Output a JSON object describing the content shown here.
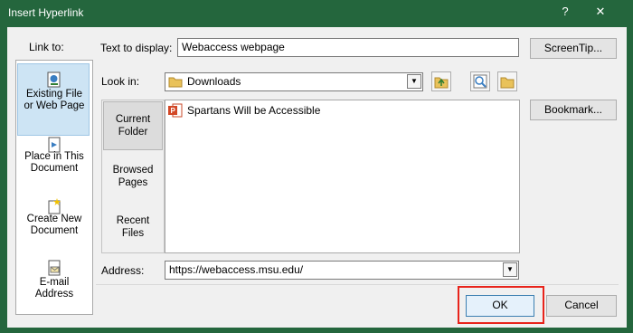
{
  "window": {
    "title": "Insert Hyperlink",
    "help_label": "?",
    "close_label": "✕"
  },
  "link_to": {
    "label": "Link to:",
    "items": [
      {
        "line1": "Existing File",
        "line2": "or Web Page",
        "icon": "existing-file-icon",
        "selected": true
      },
      {
        "line1": "Place in This",
        "line2": "Document",
        "icon": "place-in-document-icon",
        "selected": false
      },
      {
        "line1": "Create New",
        "line2": "Document",
        "icon": "new-document-icon",
        "selected": false
      },
      {
        "line1": "E-mail",
        "line2": "Address",
        "icon": "email-address-icon",
        "selected": false
      }
    ]
  },
  "text_to_display": {
    "label": "Text to display:",
    "value": "Webaccess webpage"
  },
  "screentip_button": "ScreenTip...",
  "look_in": {
    "label": "Look in:",
    "value": "Downloads",
    "folder_icon": "folder-icon"
  },
  "toolbar_icons": [
    "up-folder-icon",
    "browse-web-icon",
    "browse-file-icon"
  ],
  "bookmark_button": "Bookmark...",
  "browse_sections": [
    {
      "line1": "Current",
      "line2": "Folder",
      "selected": true
    },
    {
      "line1": "Browsed",
      "line2": "Pages",
      "selected": false
    },
    {
      "line1": "Recent",
      "line2": "Files",
      "selected": false
    }
  ],
  "files": [
    {
      "name": "Spartans Will be Accessible",
      "icon": "powerpoint-file-icon"
    }
  ],
  "address": {
    "label": "Address:",
    "value": "https://webaccess.msu.edu/"
  },
  "ok_button": "OK",
  "cancel_button": "Cancel",
  "colors": {
    "titlebar": "#24663d",
    "highlight": "#e8241b"
  }
}
